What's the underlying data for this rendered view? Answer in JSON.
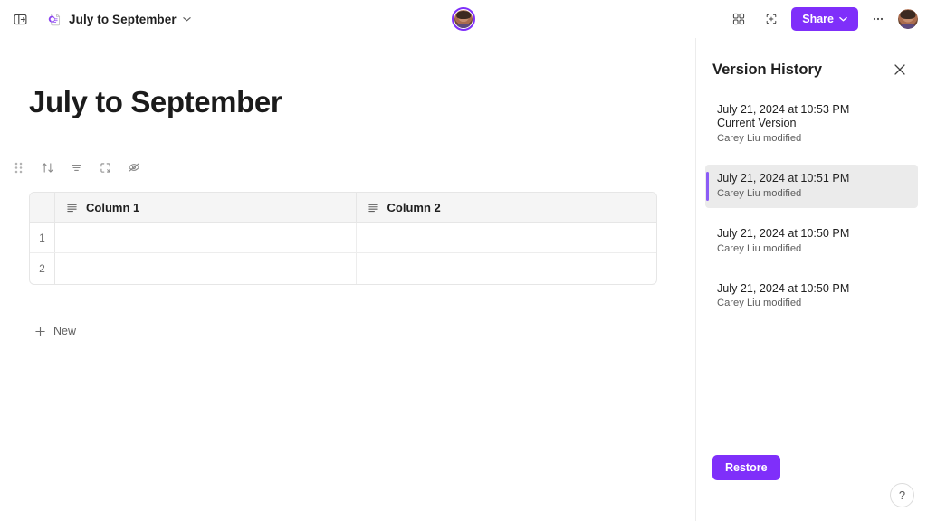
{
  "topbar": {
    "sidebar_toggle_icon": "sidebar-toggle-icon",
    "doc_icon": "loop-page-icon",
    "doc_title": "July to September",
    "doc_chevron": "⌄",
    "grid_icon": "app-grid-icon",
    "focus_icon": "focus-mode-icon",
    "share_label": "Share",
    "share_chevron": "⌄",
    "more_label": "•••",
    "account_avatar": "account-avatar",
    "presence_avatar": "presence-avatar",
    "accent_color": "#7f2ffa"
  },
  "document": {
    "title": "July to September",
    "toolbar": [
      {
        "name": "drag-handle-icon",
        "label": ""
      },
      {
        "name": "sort-icon",
        "label": ""
      },
      {
        "name": "filter-icon",
        "label": ""
      },
      {
        "name": "expand-icon",
        "label": ""
      },
      {
        "name": "hide-fields-icon",
        "label": ""
      }
    ],
    "table": {
      "columns": [
        {
          "label": "Column 1",
          "type_icon": "text-column-icon"
        },
        {
          "label": "Column 2",
          "type_icon": "text-column-icon"
        }
      ],
      "rows": [
        {
          "index": "1",
          "cells": [
            "",
            ""
          ]
        },
        {
          "index": "2",
          "cells": [
            "",
            ""
          ]
        }
      ],
      "new_row_label": "New",
      "new_row_icon": "plus-icon"
    }
  },
  "panel": {
    "title": "Version History",
    "close_icon": "close-icon",
    "versions": [
      {
        "date": "July 21, 2024 at 10:53 PM",
        "label": "Current Version",
        "author": "Carey Liu modified",
        "selected": false
      },
      {
        "date": "July 21, 2024 at 10:51 PM",
        "label": "",
        "author": "Carey Liu modified",
        "selected": true
      },
      {
        "date": "July 21, 2024 at 10:50 PM",
        "label": "",
        "author": "Carey Liu modified",
        "selected": false
      },
      {
        "date": "July 21, 2024 at 10:50 PM",
        "label": "",
        "author": "Carey Liu modified",
        "selected": false
      }
    ],
    "restore_label": "Restore",
    "help_label": "?",
    "selected_accent_color": "#8b5cf6",
    "selected_bg_color": "#ebebeb"
  }
}
